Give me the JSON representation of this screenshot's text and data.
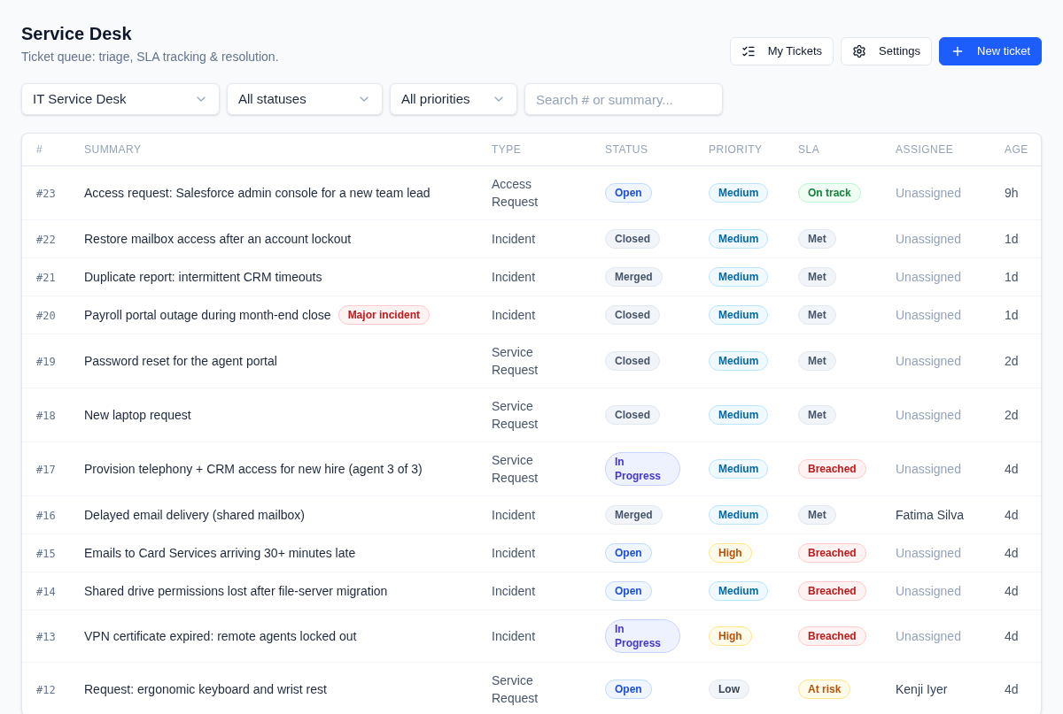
{
  "header": {
    "title": "Service Desk",
    "subtitle": "Ticket queue: triage, SLA tracking & resolution."
  },
  "actions": [
    {
      "kind": "my_tickets",
      "label": "My Tickets"
    },
    {
      "kind": "settings",
      "label": "Settings"
    },
    {
      "kind": "new_ticket",
      "label": "New ticket"
    }
  ],
  "filters": [
    {
      "kind": "queue",
      "value": "IT Service Desk"
    },
    {
      "kind": "status",
      "value": "All statuses"
    },
    {
      "kind": "priority",
      "value": "All priorities"
    }
  ],
  "search": {
    "placeholder": "Search # or summary..."
  },
  "table": {
    "columns": [
      "#",
      "SUMMARY",
      "TYPE",
      "STATUS",
      "PRIORITY",
      "SLA",
      "ASSIGNEE",
      "AGE"
    ],
    "rows": [
      {
        "id": "#23",
        "summary": "Access request: Salesforce admin console for a new team lead",
        "type": "Access Request",
        "status": {
          "label": "Open",
          "color": "#1d4ed8"
        },
        "priority": {
          "label": "Medium",
          "color": "#0369a1"
        },
        "sla": {
          "label": "On track",
          "color": "#15803d"
        },
        "assignee": {
          "name": "Unassigned",
          "assigned": false
        },
        "age": "9h"
      },
      {
        "id": "#22",
        "summary": "Restore mailbox access after an account lockout",
        "type": "Incident",
        "status": {
          "label": "Closed",
          "color": "#475569"
        },
        "priority": {
          "label": "Medium",
          "color": "#0369a1"
        },
        "sla": {
          "label": "Met",
          "color": "#475569"
        },
        "assignee": {
          "name": "Unassigned",
          "assigned": false
        },
        "age": "1d"
      },
      {
        "id": "#21",
        "summary": "Duplicate report: intermittent CRM timeouts",
        "type": "Incident",
        "status": {
          "label": "Merged",
          "color": "#475569"
        },
        "priority": {
          "label": "Medium",
          "color": "#0369a1"
        },
        "sla": {
          "label": "Met",
          "color": "#475569"
        },
        "assignee": {
          "name": "Unassigned",
          "assigned": false
        },
        "age": "1d"
      },
      {
        "id": "#20",
        "summary": "Payroll portal outage during month-end close",
        "tag": {
          "label": "Major incident",
          "color": "#b91c1c"
        },
        "type": "Incident",
        "status": {
          "label": "Closed",
          "color": "#475569"
        },
        "priority": {
          "label": "Medium",
          "color": "#0369a1"
        },
        "sla": {
          "label": "Met",
          "color": "#475569"
        },
        "assignee": {
          "name": "Unassigned",
          "assigned": false
        },
        "age": "1d"
      },
      {
        "id": "#19",
        "summary": "Password reset for the agent portal",
        "type": "Service Request",
        "status": {
          "label": "Closed",
          "color": "#475569"
        },
        "priority": {
          "label": "Medium",
          "color": "#0369a1"
        },
        "sla": {
          "label": "Met",
          "color": "#475569"
        },
        "assignee": {
          "name": "Unassigned",
          "assigned": false
        },
        "age": "2d"
      },
      {
        "id": "#18",
        "summary": "New laptop request",
        "type": "Service Request",
        "status": {
          "label": "Closed",
          "color": "#475569"
        },
        "priority": {
          "label": "Medium",
          "color": "#0369a1"
        },
        "sla": {
          "label": "Met",
          "color": "#475569"
        },
        "assignee": {
          "name": "Unassigned",
          "assigned": false
        },
        "age": "2d"
      },
      {
        "id": "#17",
        "summary": "Provision telephony + CRM access for new hire (agent 3 of 3)",
        "type": "Service Request",
        "status": {
          "label": "In Progress",
          "color": "#4338ca"
        },
        "priority": {
          "label": "Medium",
          "color": "#0369a1"
        },
        "sla": {
          "label": "Breached",
          "color": "#b91c1c"
        },
        "assignee": {
          "name": "Unassigned",
          "assigned": false
        },
        "age": "4d"
      },
      {
        "id": "#16",
        "summary": "Delayed email delivery (shared mailbox)",
        "type": "Incident",
        "status": {
          "label": "Merged",
          "color": "#475569"
        },
        "priority": {
          "label": "Medium",
          "color": "#0369a1"
        },
        "sla": {
          "label": "Met",
          "color": "#475569"
        },
        "assignee": {
          "name": "Fatima Silva",
          "assigned": true
        },
        "age": "4d"
      },
      {
        "id": "#15",
        "summary": "Emails to Card Services arriving 30+ minutes late",
        "type": "Incident",
        "status": {
          "label": "Open",
          "color": "#1d4ed8"
        },
        "priority": {
          "label": "High",
          "color": "#b45309"
        },
        "sla": {
          "label": "Breached",
          "color": "#b91c1c"
        },
        "assignee": {
          "name": "Unassigned",
          "assigned": false
        },
        "age": "4d"
      },
      {
        "id": "#14",
        "summary": "Shared drive permissions lost after file-server migration",
        "type": "Incident",
        "status": {
          "label": "Open",
          "color": "#1d4ed8"
        },
        "priority": {
          "label": "Medium",
          "color": "#0369a1"
        },
        "sla": {
          "label": "Breached",
          "color": "#b91c1c"
        },
        "assignee": {
          "name": "Unassigned",
          "assigned": false
        },
        "age": "4d"
      },
      {
        "id": "#13",
        "summary": "VPN certificate expired: remote agents locked out",
        "type": "Incident",
        "status": {
          "label": "In Progress",
          "color": "#4338ca"
        },
        "priority": {
          "label": "High",
          "color": "#b45309"
        },
        "sla": {
          "label": "Breached",
          "color": "#b91c1c"
        },
        "assignee": {
          "name": "Unassigned",
          "assigned": false
        },
        "age": "4d"
      },
      {
        "id": "#12",
        "summary": "Request: ergonomic keyboard and wrist rest",
        "type": "Service Request",
        "status": {
          "label": "Open",
          "color": "#1d4ed8"
        },
        "priority": {
          "label": "Low",
          "color": "#334155"
        },
        "sla": {
          "label": "At risk",
          "color": "#b45309"
        },
        "assignee": {
          "name": "Kenji Iyer",
          "assigned": true
        },
        "age": "4d"
      }
    ]
  }
}
